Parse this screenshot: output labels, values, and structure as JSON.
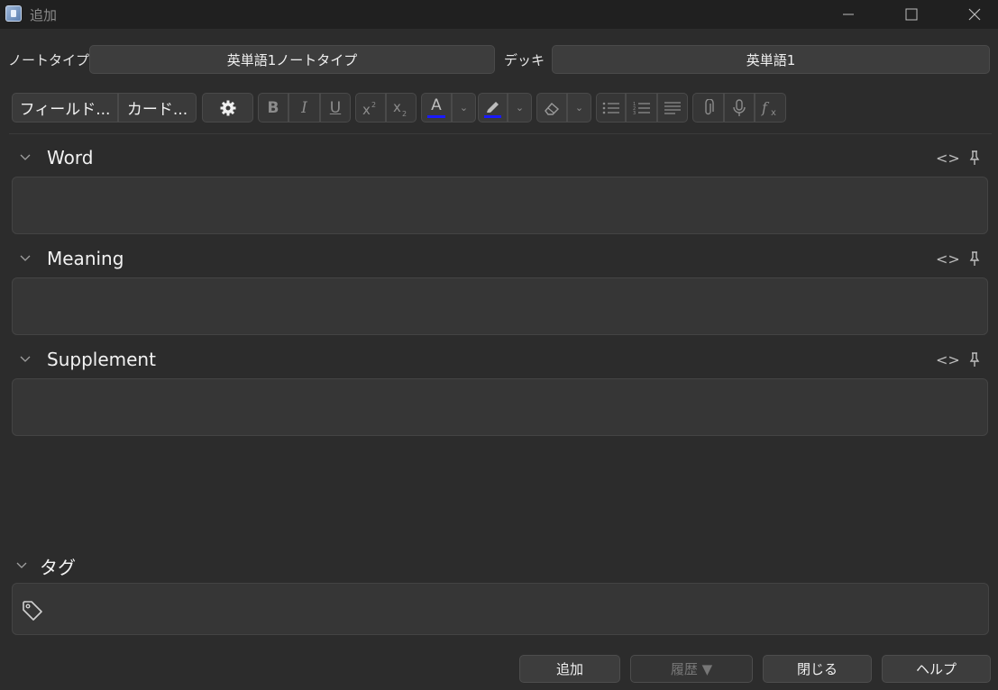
{
  "window": {
    "title": "追加"
  },
  "top": {
    "notetype_label": "ノートタイプ",
    "notetype_value": "英単語1ノートタイプ",
    "deck_label": "デッキ",
    "deck_value": "英単語1"
  },
  "toolbar": {
    "fields_label": "フィールド...",
    "cards_label": "カード...",
    "bold": "B",
    "italic": "I",
    "underline": "U",
    "text_color": "#1a1aff",
    "highlight_color": "#1a1aff"
  },
  "fields": [
    {
      "name": "Word"
    },
    {
      "name": "Meaning"
    },
    {
      "name": "Supplement"
    }
  ],
  "tags": {
    "label": "タグ"
  },
  "buttons": {
    "add": "追加",
    "history": "履歴 ▼",
    "close": "閉じる",
    "help": "ヘルプ"
  }
}
